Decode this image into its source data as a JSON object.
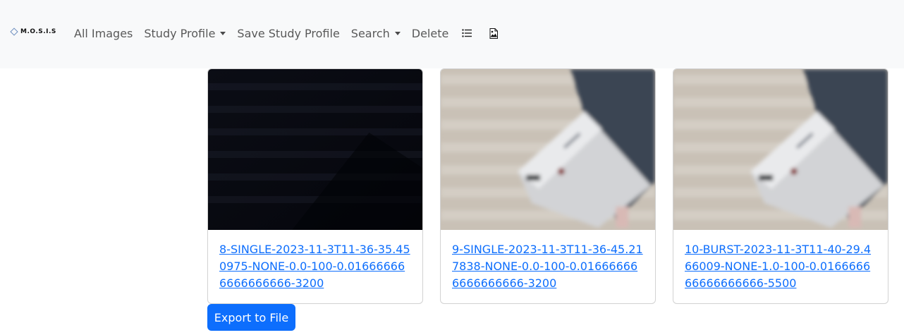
{
  "brand": {
    "name": "M.O.S.I.S"
  },
  "nav": {
    "all_images": "All Images",
    "study_profile": "Study Profile",
    "save_study_profile": "Save Study Profile",
    "search": "Search",
    "delete": "Delete",
    "list_icon": "list-icon",
    "image_file_icon": "image-file-icon"
  },
  "cards": [
    {
      "link": "8-SINGLE-2023-11-3T11-36-35.450975-NONE-0.0-100-0.016666666666666666-3200",
      "thumbnail": "dark"
    },
    {
      "link": "9-SINGLE-2023-11-3T11-36-45.217838-NONE-0.0-100-0.016666666666666666-3200",
      "thumbnail": "blurred-desk"
    },
    {
      "link": "10-BURST-2023-11-3T11-40-29.466009-NONE-1.0-100-0.016666666666666666-5500",
      "thumbnail": "blurred-desk"
    }
  ],
  "export_button": "Export to File",
  "colors": {
    "link": "#0d6efd",
    "primary": "#0d6efd",
    "navbar_bg": "#f8f9fa"
  }
}
